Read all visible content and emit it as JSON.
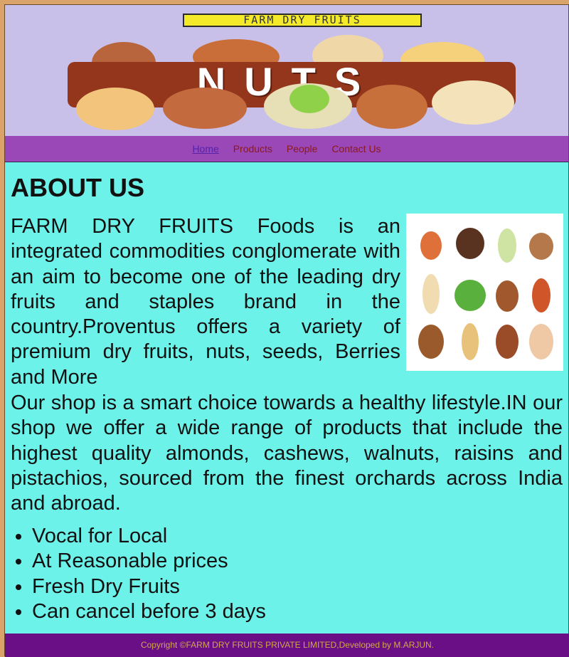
{
  "banner": {
    "title": "FARM DRY FRUITS",
    "word": "NUTS"
  },
  "nav": {
    "items": [
      {
        "label": "Home",
        "active": true
      },
      {
        "label": "Products"
      },
      {
        "label": "People"
      },
      {
        "label": "Contact Us"
      }
    ]
  },
  "main": {
    "heading": "ABOUT US",
    "paragraph1": "FARM DRY FRUITS Foods is an integrated commodities conglomerate with an aim to become one of the leading dry fruits and staples brand in the country.Proventus offers a variety of premium dry fruits, nuts, seeds, Berries and More",
    "paragraph2": "Our shop is a smart choice towards a healthy lifestyle.IN our shop we offer a wide range of products that include the highest quality almonds, cashews, walnuts, raisins and pistachios, sourced from the finest orchards across India and abroad.",
    "features": [
      "Vocal for Local",
      "At Reasonable prices",
      "Fresh Dry Fruits",
      "Can cancel before 3 days"
    ]
  },
  "footer": {
    "copyright": "Copyright ©FARM DRY FRUITS PRIVATE LIMITED,Developed by M.ARJUN."
  },
  "colors": {
    "page_bg": "#d9a36a",
    "banner_bg": "#c9c0ea",
    "nav_bg": "#9a47b8",
    "main_bg": "#6df2e9",
    "footer_bg": "#6b0f86",
    "footer_text": "#cfa84a"
  }
}
